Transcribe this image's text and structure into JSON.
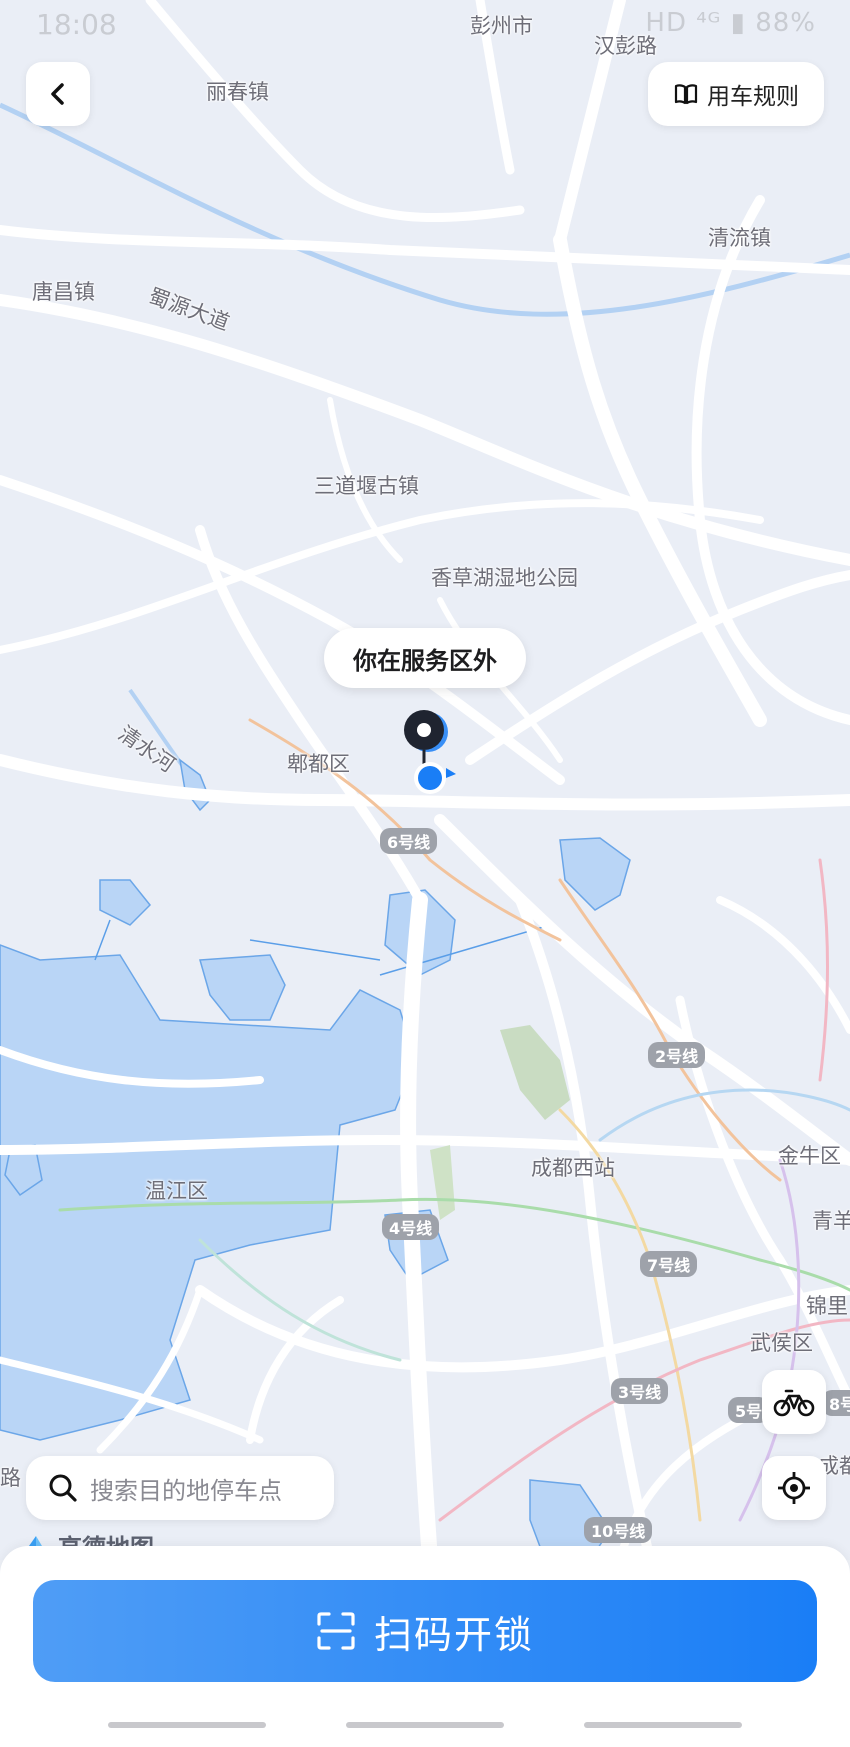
{
  "status_bar": {
    "time": "18:08",
    "right": "HD ⁴ᴳ ▮ 88%"
  },
  "header": {
    "back_icon": "chevron-left-icon",
    "rules_icon": "book-icon",
    "rules_label": "用车规则"
  },
  "map": {
    "labels": {
      "pengzhou": "彭州市",
      "hanpeng_road": "汉彭路",
      "lichun": "丽春镇",
      "qingliu": "清流镇",
      "tangchang": "唐昌镇",
      "shuyuan_ave": "蜀源大道",
      "sandaoyan": "三道堰古镇",
      "xiangcaohu": "香草湖湿地公园",
      "qingshui_river": "清水河",
      "pidu": "郫都区",
      "wenjiang": "温江区",
      "chengdu_west": "成都西站",
      "jinniu": "金牛区",
      "qingyang": "青羊",
      "jinli": "锦里",
      "wuhou": "武侯区",
      "cheng": "成都",
      "lu": "路"
    },
    "metro_badges": {
      "line6": "6号线",
      "line2": "2号线",
      "line4": "4号线",
      "line7": "7号线",
      "line3": "3号线",
      "line5": "5号",
      "line8": "8号",
      "line10": "10号线"
    },
    "provider": "高德地图"
  },
  "tooltip": {
    "text": "你在服务区外"
  },
  "controls": {
    "bike_icon": "bicycle-icon",
    "locate_icon": "locate-icon"
  },
  "search": {
    "placeholder": "搜索目的地停车点"
  },
  "bottom": {
    "scan_label": "扫码开锁"
  },
  "colors": {
    "accent": "#1a7ef6",
    "service_area": "#b9d5f6",
    "map_bg": "#eaeef6"
  }
}
